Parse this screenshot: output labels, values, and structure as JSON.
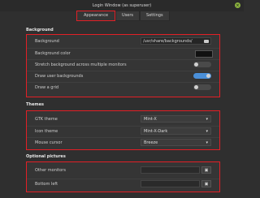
{
  "window": {
    "title": "Login Window (as superuser)",
    "close_icon": "close-icon"
  },
  "tabs": [
    {
      "label": "Appearance",
      "active": true
    },
    {
      "label": "Users",
      "active": false
    },
    {
      "label": "Settings",
      "active": false
    }
  ],
  "background": {
    "section": "Background",
    "rows": [
      {
        "label": "Background",
        "value": "/usr/share/backgrounds/"
      },
      {
        "label": "Background color"
      },
      {
        "label": "Stretch background across multiple monitors",
        "enabled": false
      },
      {
        "label": "Draw user backgrounds",
        "enabled": true
      },
      {
        "label": "Draw a grid",
        "enabled": false
      }
    ]
  },
  "themes": {
    "section": "Themes",
    "rows": [
      {
        "label": "GTK theme",
        "value": "Mint-X"
      },
      {
        "label": "Icon theme",
        "value": "Mint-X-Dark"
      },
      {
        "label": "Mouse cursor",
        "value": "Breeze"
      }
    ]
  },
  "optional_pictures": {
    "section": "Optional pictures",
    "rows": [
      {
        "label": "Other monitors"
      },
      {
        "label": "Bottom left"
      }
    ]
  },
  "colors": {
    "highlight": "#e21f26",
    "toggle_on": "#4a8fd8",
    "close": "#8ab13f"
  }
}
